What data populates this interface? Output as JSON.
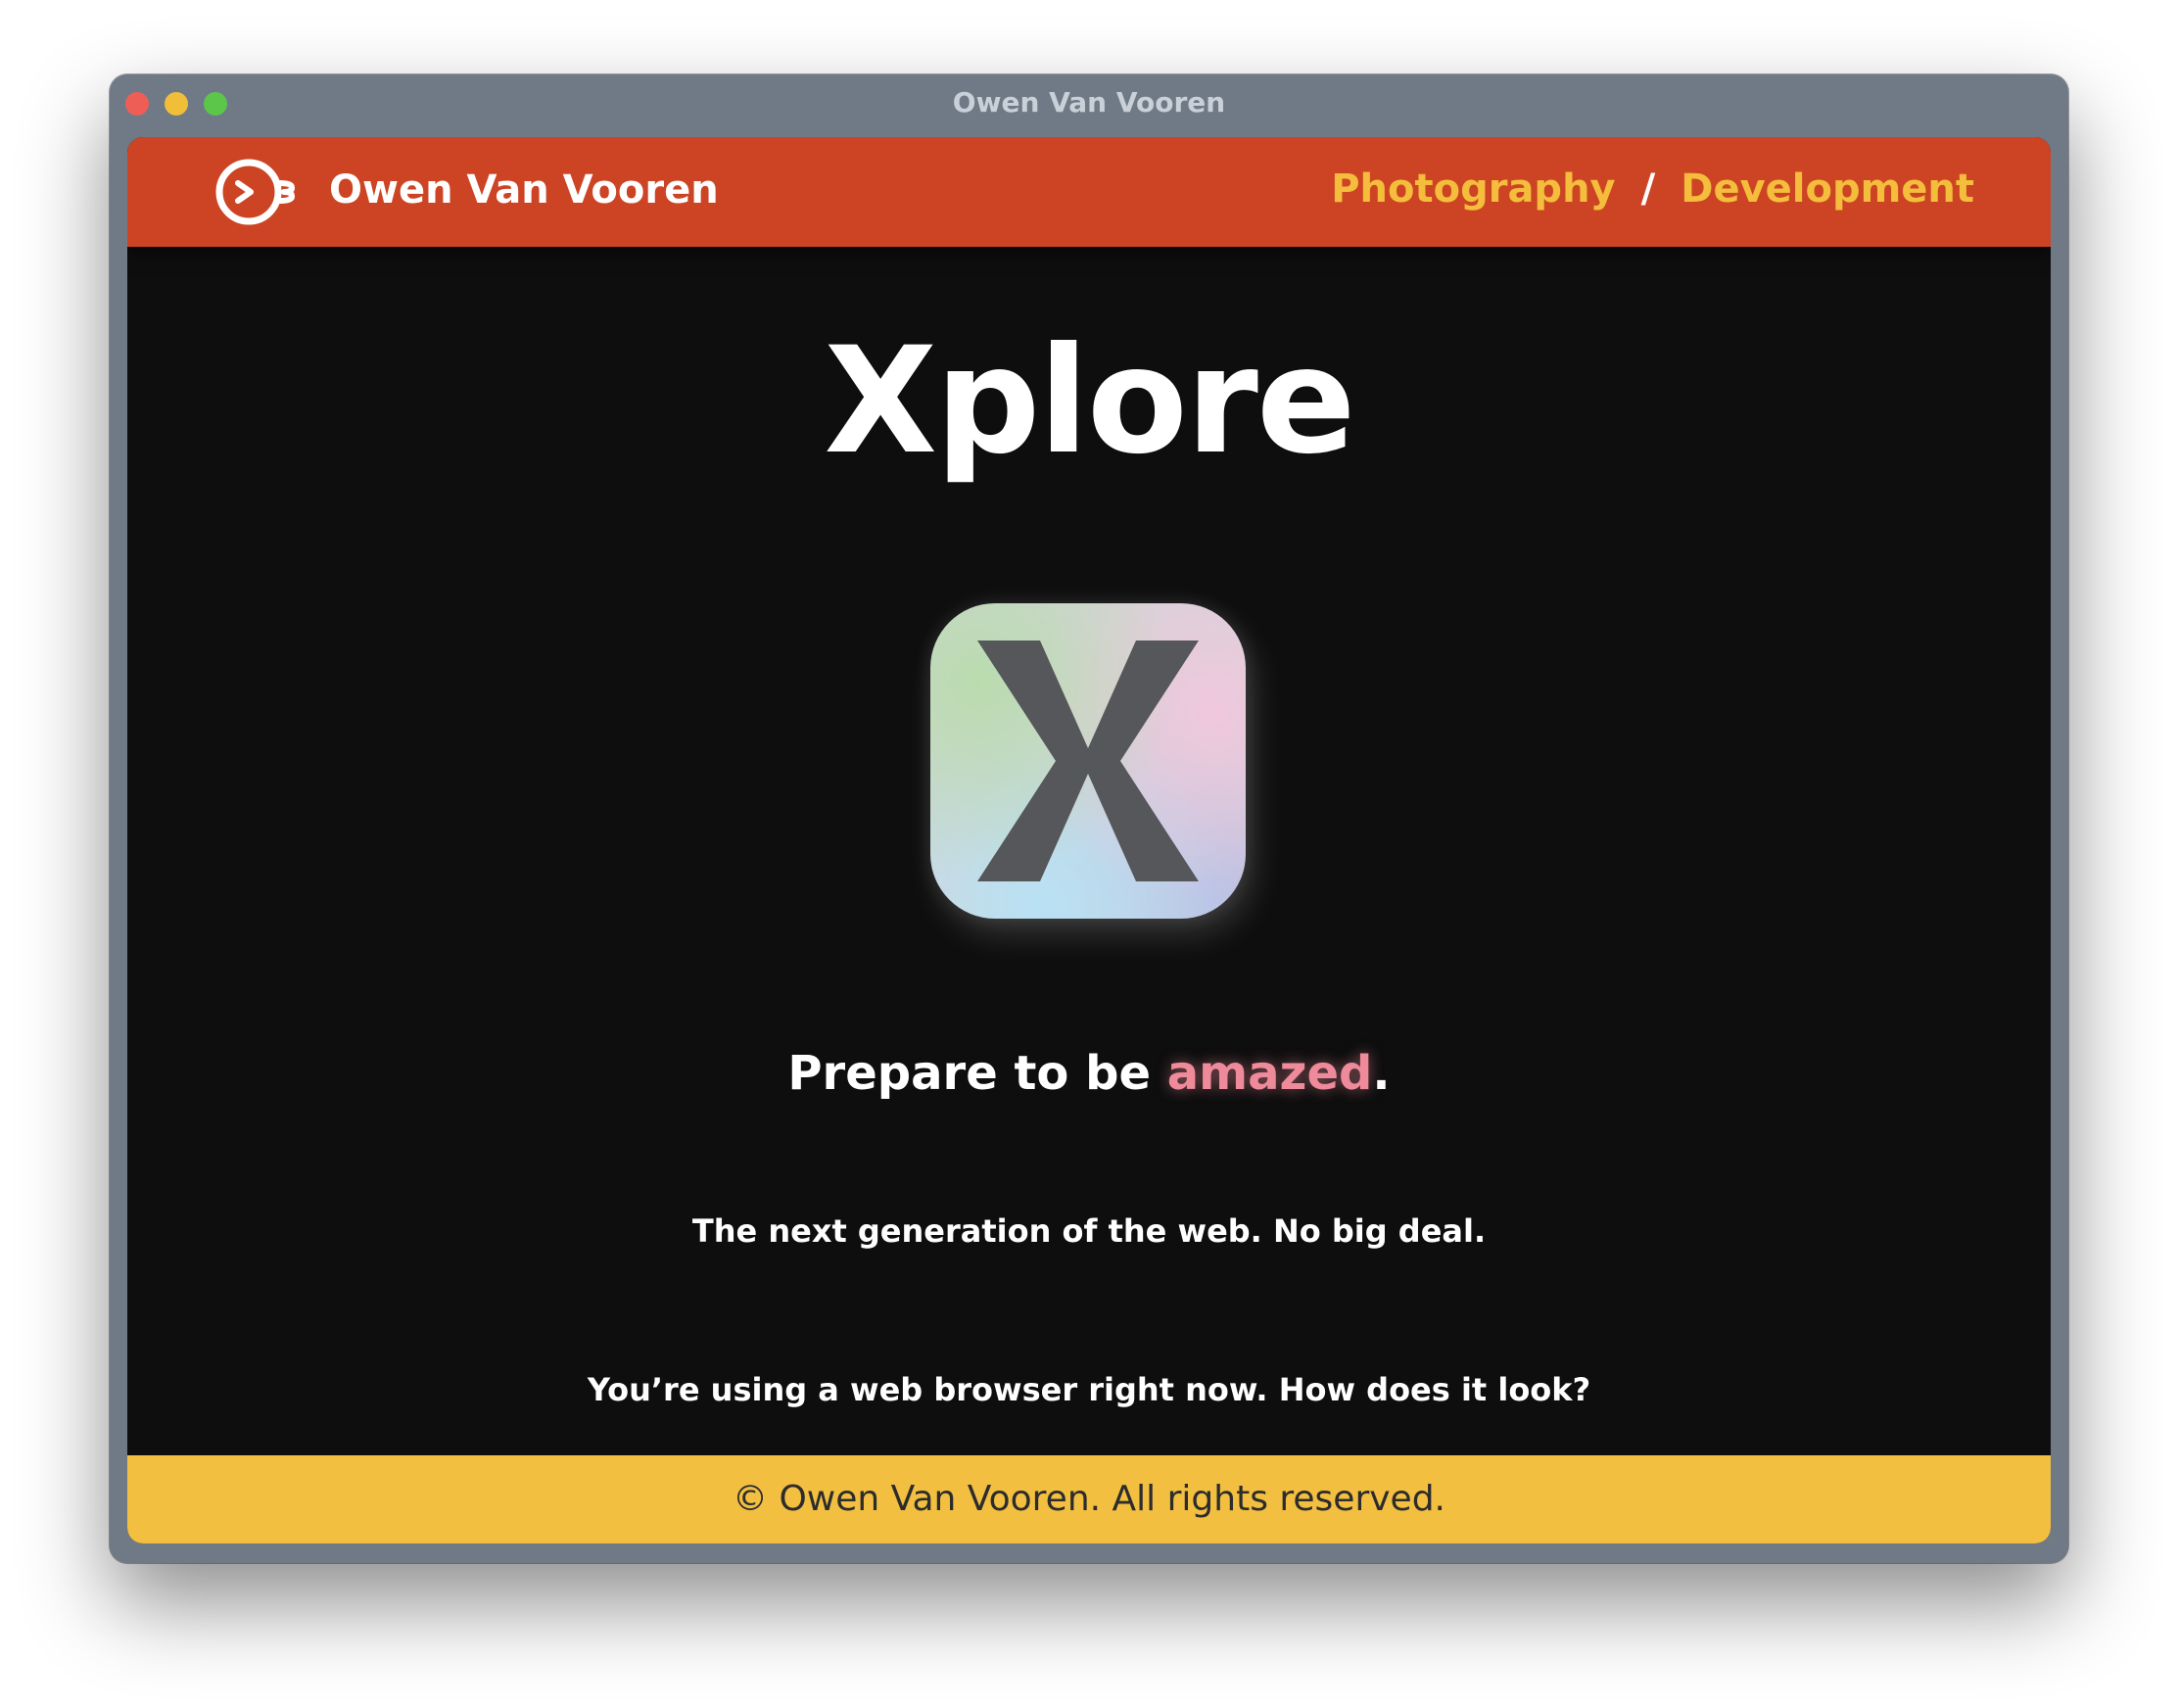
{
  "window": {
    "title": "Owen Van Vooren"
  },
  "header": {
    "brand": "Owen Van Vooren",
    "nav": [
      {
        "label": "Photography"
      },
      {
        "label": "Development"
      }
    ],
    "separator": "/"
  },
  "main": {
    "title": "Xplore",
    "app_icon": "xplore-app-icon",
    "tagline_prefix": "Prepare to be ",
    "tagline_accent": "amazed",
    "tagline_suffix": ".",
    "line1": "The next generation of the web. No big deal.",
    "line2": "You’re using a web browser right now. How does it look?"
  },
  "footer": {
    "copyright": "© Owen Van Vooren. All rights reserved."
  },
  "colors": {
    "header_bg": "#cd4424",
    "nav_link": "#f4bd3c",
    "footer_bg": "#f3bf41",
    "page_bg": "#0e0e0e",
    "accent_text": "#ee8a9a"
  }
}
